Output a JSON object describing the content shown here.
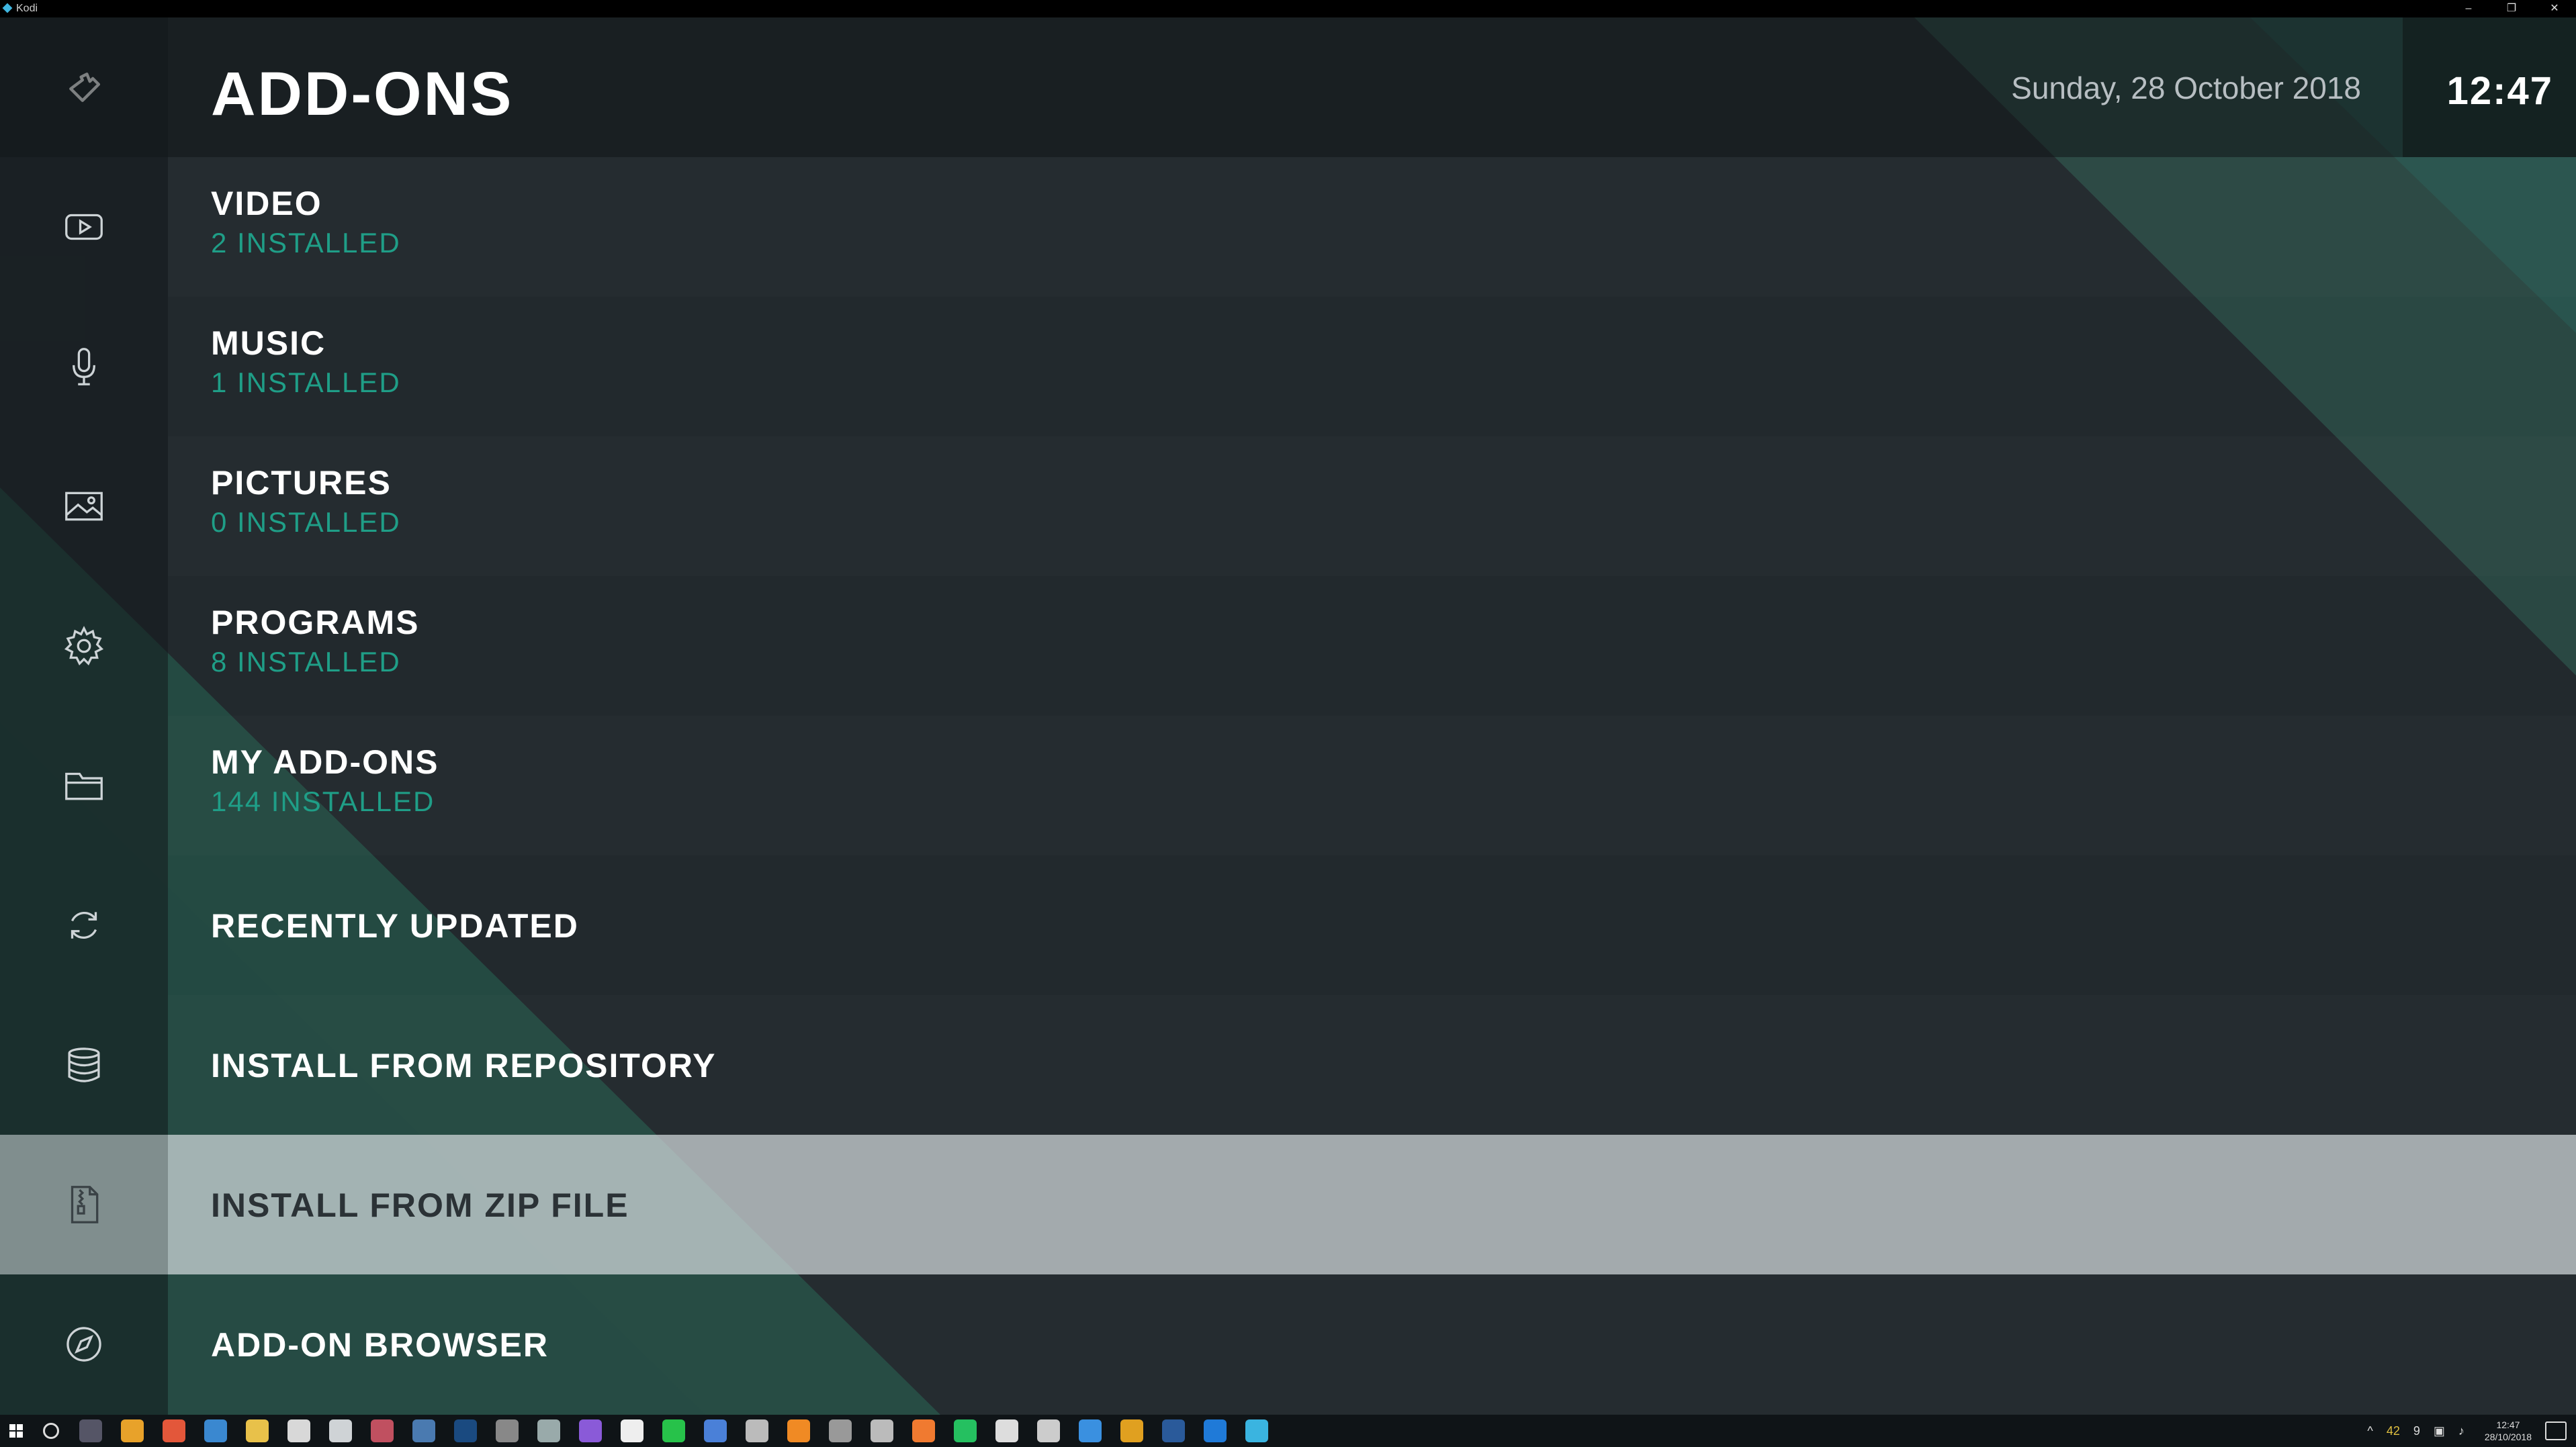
{
  "window": {
    "title": "Kodi"
  },
  "header": {
    "title": "ADD-ONS",
    "date": "Sunday, 28 October 2018",
    "time": "12:47"
  },
  "menu": [
    {
      "label": "VIDEO",
      "sub": "2 INSTALLED",
      "icon": "video-icon"
    },
    {
      "label": "MUSIC",
      "sub": "1 INSTALLED",
      "icon": "microphone-icon"
    },
    {
      "label": "PICTURES",
      "sub": "0 INSTALLED",
      "icon": "picture-icon"
    },
    {
      "label": "PROGRAMS",
      "sub": "8 INSTALLED",
      "icon": "gear-icon"
    },
    {
      "label": "MY ADD-ONS",
      "sub": "144 INSTALLED",
      "icon": "folder-icon"
    },
    {
      "label": "RECENTLY UPDATED",
      "icon": "refresh-icon"
    },
    {
      "label": "INSTALL FROM REPOSITORY",
      "icon": "database-icon"
    },
    {
      "label": "INSTALL FROM ZIP FILE",
      "icon": "zip-file-icon",
      "focused": true
    },
    {
      "label": "ADD-ON BROWSER",
      "icon": "compass-icon"
    }
  ],
  "taskbar": {
    "tray": {
      "temp": "42",
      "count": "9",
      "time": "12:47",
      "date": "28/10/2018"
    }
  },
  "colors": {
    "accent": "#1f9e87",
    "background": "#22292d",
    "focus": "#d6dcdf"
  }
}
